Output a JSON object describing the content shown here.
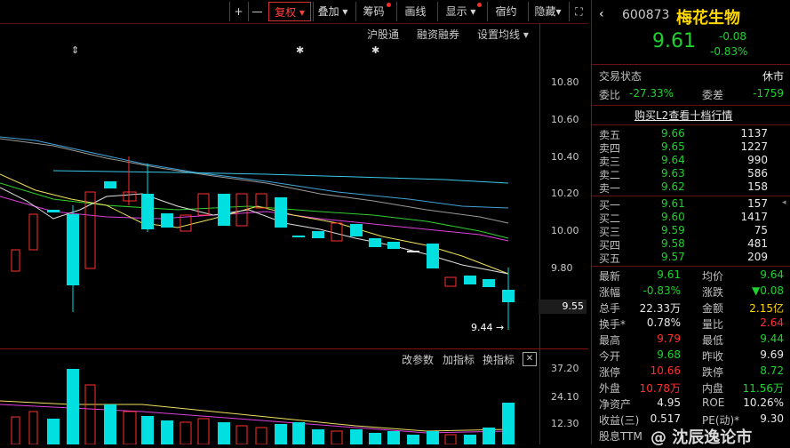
{
  "toolbar": {
    "plus": "+",
    "minus": "—",
    "fuquan": "复权",
    "diejia": "叠加",
    "chouma": "筹码",
    "huaxian": "画线",
    "xianshi": "显示",
    "quyue": "宿约",
    "yincang": "隐藏",
    "fullscreen": "⛶"
  },
  "sublinks": {
    "hugutong": "沪股通",
    "rongzi": "融资融券",
    "shezhi": "设置均线"
  },
  "price_axis": [
    "10.80",
    "10.60",
    "10.40",
    "10.20",
    "10.00",
    "9.80"
  ],
  "current_price_label": "9.55",
  "low_marker": "9.44",
  "indicator_links": {
    "params": "改参数",
    "add": "加指标",
    "switch": "换指标"
  },
  "volume_axis": [
    "37.20",
    "24.10",
    "12.30"
  ],
  "stock": {
    "code": "600873",
    "name": "梅花生物",
    "price": "9.61",
    "change": "-0.08",
    "change_pct": "-0.83%"
  },
  "status": {
    "label": "交易状态",
    "value": "休市",
    "weibi_label": "委比",
    "weibi": "-27.33%",
    "weicha_label": "委差",
    "weicha": "-1759",
    "l2_link": "购买L2查看十档行情"
  },
  "asks": [
    {
      "name": "卖五",
      "price": "9.66",
      "qty": "1137"
    },
    {
      "name": "卖四",
      "price": "9.65",
      "qty": "1227"
    },
    {
      "name": "卖三",
      "price": "9.64",
      "qty": "990"
    },
    {
      "name": "卖二",
      "price": "9.63",
      "qty": "586"
    },
    {
      "name": "卖一",
      "price": "9.62",
      "qty": "158"
    }
  ],
  "bids": [
    {
      "name": "买一",
      "price": "9.61",
      "qty": "157"
    },
    {
      "name": "买二",
      "price": "9.60",
      "qty": "1417"
    },
    {
      "name": "买三",
      "price": "9.59",
      "qty": "75"
    },
    {
      "name": "买四",
      "price": "9.58",
      "qty": "481"
    },
    {
      "name": "买五",
      "price": "9.57",
      "qty": "209"
    }
  ],
  "stats": [
    {
      "l": "最新",
      "v": "9.61",
      "c1": "green",
      "l2": "均价",
      "v2": "9.64",
      "c2": "green"
    },
    {
      "l": "涨幅",
      "v": "-0.83%",
      "c1": "green",
      "l2": "涨跌",
      "v2": "▼0.08",
      "c2": "green"
    },
    {
      "l": "总手",
      "v": "22.33万",
      "c1": "white",
      "l2": "金额",
      "v2": "2.15亿",
      "c2": "yellow"
    },
    {
      "l": "换手*",
      "v": "0.78%",
      "c1": "white",
      "l2": "量比",
      "v2": "2.64",
      "c2": "red"
    },
    {
      "l": "最高",
      "v": "9.79",
      "c1": "red",
      "l2": "最低",
      "v2": "9.44",
      "c2": "green"
    },
    {
      "l": "今开",
      "v": "9.68",
      "c1": "green",
      "l2": "昨收",
      "v2": "9.69",
      "c2": "white"
    },
    {
      "l": "涨停",
      "v": "10.66",
      "c1": "red",
      "l2": "跌停",
      "v2": "8.72",
      "c2": "green"
    },
    {
      "l": "外盘",
      "v": "10.78万",
      "c1": "red",
      "l2": "内盘",
      "v2": "11.56万",
      "c2": "green"
    },
    {
      "l": "净资产",
      "v": "4.95",
      "c1": "white",
      "l2": "ROE",
      "v2": "10.26%",
      "c2": "white"
    },
    {
      "l": "收益(三)",
      "v": "0.517",
      "c1": "white",
      "l2": "PE(动)*",
      "v2": "9.30",
      "c2": "white"
    },
    {
      "l": "股息TTM",
      "v": "",
      "c1": "white",
      "l2": "",
      "v2": "",
      "c2": "white"
    }
  ],
  "watermark": "@ 沈辰逸论市",
  "colors": {
    "up": "#ff3030",
    "down": "#00e0e0",
    "accent": "#ffd700",
    "frame": "#8a1010"
  }
}
